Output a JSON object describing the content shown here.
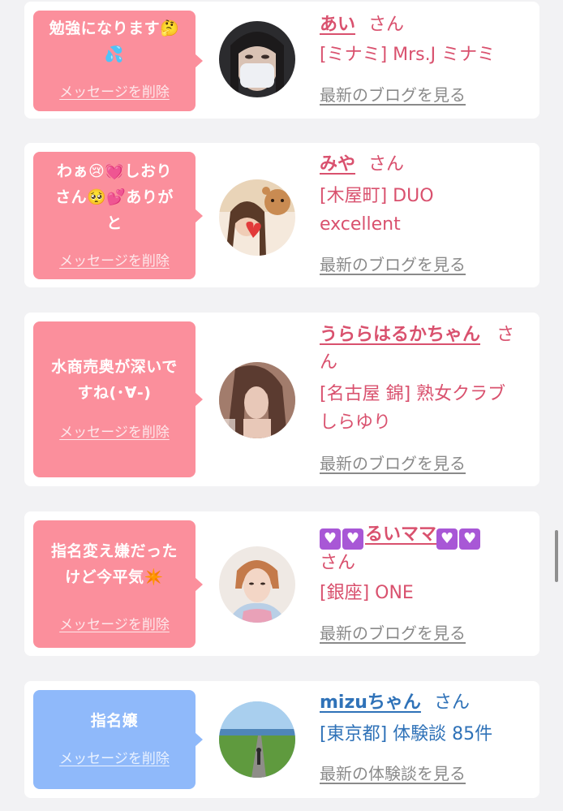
{
  "colors": {
    "pink_bubble": "#fb8f9c",
    "blue_bubble": "#8fb9fa",
    "pink_text": "#d9516e",
    "blue_text": "#2f72b8",
    "link_gray": "#8a8a8a",
    "background": "#f2f2f4"
  },
  "messages": [
    {
      "text_line1": "勉強になります🤔",
      "text_line2": "💦",
      "delete_label": "メッセージを削除",
      "name": "あい",
      "honorific": "さん",
      "detail_line1": "[ミナミ] Mrs.J ミナミ",
      "blog_link": "最新のブログを見る"
    },
    {
      "text_line1": "わぁ😢💓しおり",
      "text_line2": "さん🥺💕ありが",
      "text_line3": "と",
      "delete_label": "メッセージを削除",
      "name": "みや",
      "honorific": "さん",
      "detail_line1": "[木屋町] DUO",
      "detail_line2": "excellent",
      "blog_link": "最新のブログを見る"
    },
    {
      "text_line1": "水商売奥が深いで",
      "text_line2": "すね(･∀-)",
      "delete_label": "メッセージを削除",
      "name": "うららはるかちゃん",
      "honorific_part1": "さ",
      "honorific_part2": "ん",
      "detail_line1": "[名古屋 錦] 熟女クラブ",
      "detail_line2": "しらゆり",
      "blog_link": "最新のブログを見る"
    },
    {
      "text_line1": "指名変え嫌だった",
      "text_line2": "けど今平気✴️",
      "delete_label": "メッセージを削除",
      "name": "💜💜るいママ💜💜",
      "name_core": "るいママ",
      "honorific": "さん",
      "detail_line1": "[銀座] ONE",
      "blog_link": "最新のブログを見る"
    },
    {
      "text_line1": "指名嬢",
      "delete_label": "メッセージを削除",
      "name": "mizuちゃん",
      "honorific": "さん",
      "detail_line1": "[東京都] 体験談 85件",
      "blog_link": "最新の体験談を見る"
    }
  ],
  "icons": {
    "heart_box": "purple-heart-icon",
    "avatar": "user-avatar-photo"
  }
}
